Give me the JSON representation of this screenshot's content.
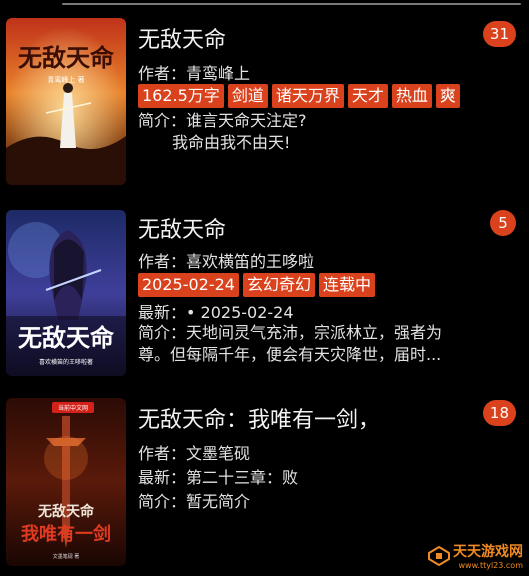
{
  "books": [
    {
      "title": "无敌天命",
      "badge": "31",
      "author_label": "作者：",
      "author": "青鸾峰上",
      "tags": [
        "162.5万字",
        "剑道",
        "诸天万界",
        "天才",
        "热血",
        "爽"
      ],
      "intro_label": "简介：",
      "intro_line1": "谁言天命天注定?",
      "intro_line2": "我命由我不由天!",
      "cover": {
        "title": "无敌天命",
        "author": "青鸾峰上 著"
      }
    },
    {
      "title": "无敌天命",
      "badge": "5",
      "author_label": "作者：",
      "author": "喜欢横笛的王哆啦",
      "tags": [
        "2025-02-24",
        "玄幻奇幻",
        "连载中"
      ],
      "latest_label": "最新：",
      "latest": "• 2025-02-24",
      "intro_label": "简介：",
      "intro_line1": "天地间灵气充沛，宗派林立，强者为",
      "intro_line2": "尊。但每隔千年，便会有天灾降世，届时...",
      "cover": {
        "title": "无敌天命",
        "author": "喜欢横笛的王哆啦著"
      }
    },
    {
      "title": "无敌天命：我唯有一剑，",
      "badge": "18",
      "author_label": "作者：",
      "author": "文墨笔砚",
      "latest_label": "最新：",
      "latest": "第二十三章：败",
      "intro_label": "简介：",
      "intro": "暂无简介",
      "cover": {
        "title": "无敌天命",
        "subtitle": "我唯有一剑",
        "brand": "当前中文网",
        "author": "文墨笔砚 著"
      }
    }
  ],
  "watermark": {
    "text": "天天游戏网",
    "url": "www.ttyl23.com"
  },
  "colors": {
    "accent": "#d9421d",
    "background": "#000000"
  }
}
